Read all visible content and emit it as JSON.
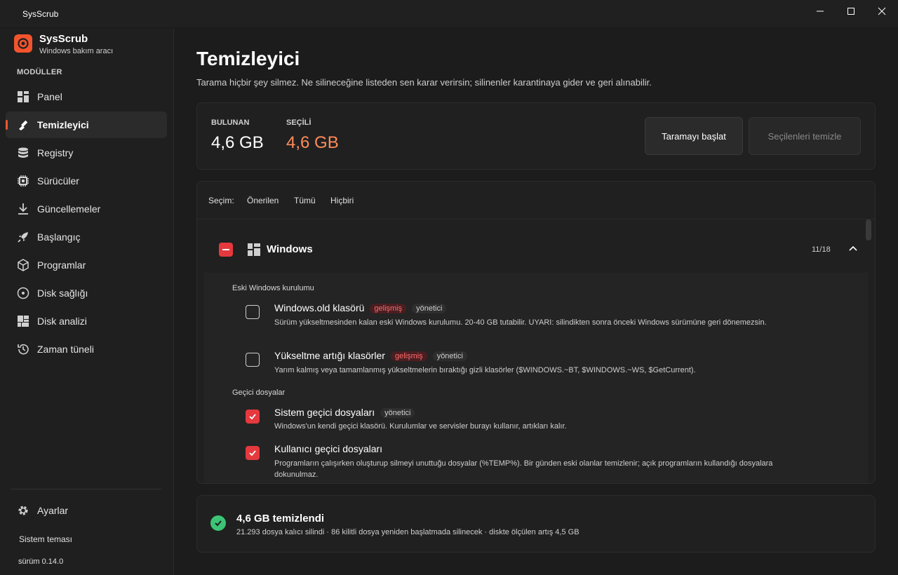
{
  "window": {
    "title": "SysScrub"
  },
  "brand": {
    "name": "SysScrub",
    "subtitle": "Windows bakım aracı",
    "accent": "#f2542d"
  },
  "sidebar": {
    "section_label": "MODÜLLER",
    "items": [
      {
        "label": "Panel",
        "icon": "dashboard-icon"
      },
      {
        "label": "Temizleyici",
        "icon": "broom-icon",
        "active": true
      },
      {
        "label": "Registry",
        "icon": "database-icon"
      },
      {
        "label": "Sürücüler",
        "icon": "chip-icon"
      },
      {
        "label": "Güncellemeler",
        "icon": "download-icon"
      },
      {
        "label": "Başlangıç",
        "icon": "rocket-icon"
      },
      {
        "label": "Programlar",
        "icon": "package-icon"
      },
      {
        "label": "Disk sağlığı",
        "icon": "disk-icon"
      },
      {
        "label": "Disk analizi",
        "icon": "treemap-icon"
      },
      {
        "label": "Zaman tüneli",
        "icon": "history-icon"
      }
    ],
    "settings_label": "Ayarlar",
    "theme_label": "Sistem teması",
    "version": "sürüm 0.14.0"
  },
  "page": {
    "title": "Temizleyici",
    "description": "Tarama hiçbir şey silmez. Ne silineceğine listeden sen karar verirsin; silinenler karantinaya gider ve geri alınabilir."
  },
  "summary": {
    "found_label": "BULUNAN",
    "found_value": "4,6 GB",
    "selected_label": "SEÇİLİ",
    "selected_value": "4,6 GB",
    "scan_button": "Taramayı başlat",
    "clean_button": "Seçilenleri temizle"
  },
  "selection": {
    "label": "Seçim:",
    "recommended": "Önerilen",
    "all": "Tümü",
    "none": "Hiçbiri"
  },
  "group": {
    "name": "Windows",
    "count": "11/18",
    "subsections": [
      {
        "label": "Eski Windows kurulumu",
        "items": [
          {
            "name": "Windows.old klasörü",
            "badges": [
              "gelişmiş",
              "yönetici"
            ],
            "checked": false,
            "description": "Sürüm yükseltmesinden kalan eski Windows kurulumu. 20-40 GB tutabilir. UYARI: silindikten sonra önceki Windows sürümüne geri dönemezsin."
          },
          {
            "name": "Yükseltme artığı klasörler",
            "badges": [
              "gelişmiş",
              "yönetici"
            ],
            "checked": false,
            "description": "Yarım kalmış veya tamamlanmış yükseltmelerin bıraktığı gizli klasörler ($WINDOWS.~BT, $WINDOWS.~WS, $GetCurrent)."
          }
        ]
      },
      {
        "label": "Geçici dosyalar",
        "items": [
          {
            "name": "Sistem geçici dosyaları",
            "badges": [
              "yönetici"
            ],
            "checked": true,
            "description": "Windows'un kendi geçici klasörü. Kurulumlar ve servisler burayı kullanır, artıkları kalır."
          },
          {
            "name": "Kullanıcı geçici dosyaları",
            "badges": [],
            "checked": true,
            "description": "Programların çalışırken oluşturup silmeyi unuttuğu dosyalar (%TEMP%). Bir günden eski olanlar temizlenir; açık programların kullandığı dosyalara dokunulmaz."
          }
        ]
      }
    ]
  },
  "result": {
    "title": "4,6 GB temizlendi",
    "description": "21.293 dosya kalıcı silindi · 86 kilitli dosya yeniden başlatmada silinecek · diskte ölçülen artış 4,5 GB"
  }
}
